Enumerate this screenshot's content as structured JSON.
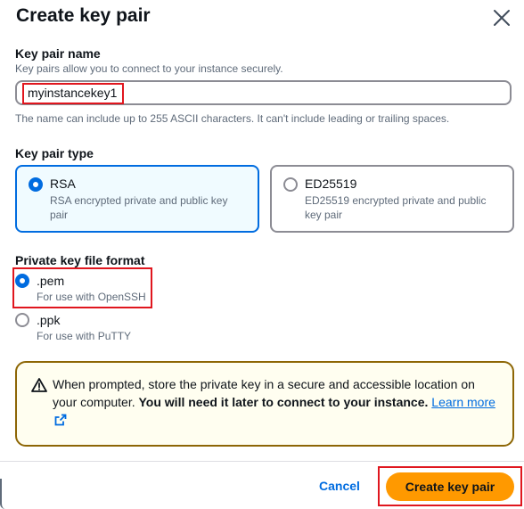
{
  "dialog": {
    "title": "Create key pair",
    "close_icon": "close-icon"
  },
  "key_name": {
    "label": "Key pair name",
    "description": "Key pairs allow you to connect to your instance securely.",
    "value": "myinstancekey1",
    "constraint": "The name can include up to 255 ASCII characters. It can't include leading or trailing spaces."
  },
  "key_type": {
    "label": "Key pair type",
    "options": [
      {
        "title": "RSA",
        "desc_line1": "RSA encrypted private and public key",
        "desc_line2": "pair",
        "selected": true
      },
      {
        "title": "ED25519",
        "desc_line1": "ED25519 encrypted private and public",
        "desc_line2": "key pair",
        "selected": false
      }
    ]
  },
  "file_format": {
    "label": "Private key file format",
    "options": [
      {
        "title": ".pem",
        "desc": "For use with OpenSSH",
        "selected": true
      },
      {
        "title": ".ppk",
        "desc": "For use with PuTTY",
        "selected": false
      }
    ]
  },
  "alert": {
    "icon": "warning-icon",
    "text_normal": "When prompted, store the private key in a secure and accessible location on your computer. ",
    "text_bold": "You will need it later to connect to your instance.",
    "link_text": "Learn more",
    "link_icon": "external-link-icon"
  },
  "footer": {
    "cancel_label": "Cancel",
    "create_label": "Create key pair"
  },
  "colors": {
    "primary": "#ff9900",
    "selected": "#006ce0",
    "highlight": "#e0161e",
    "warning_border": "#8d6605"
  }
}
